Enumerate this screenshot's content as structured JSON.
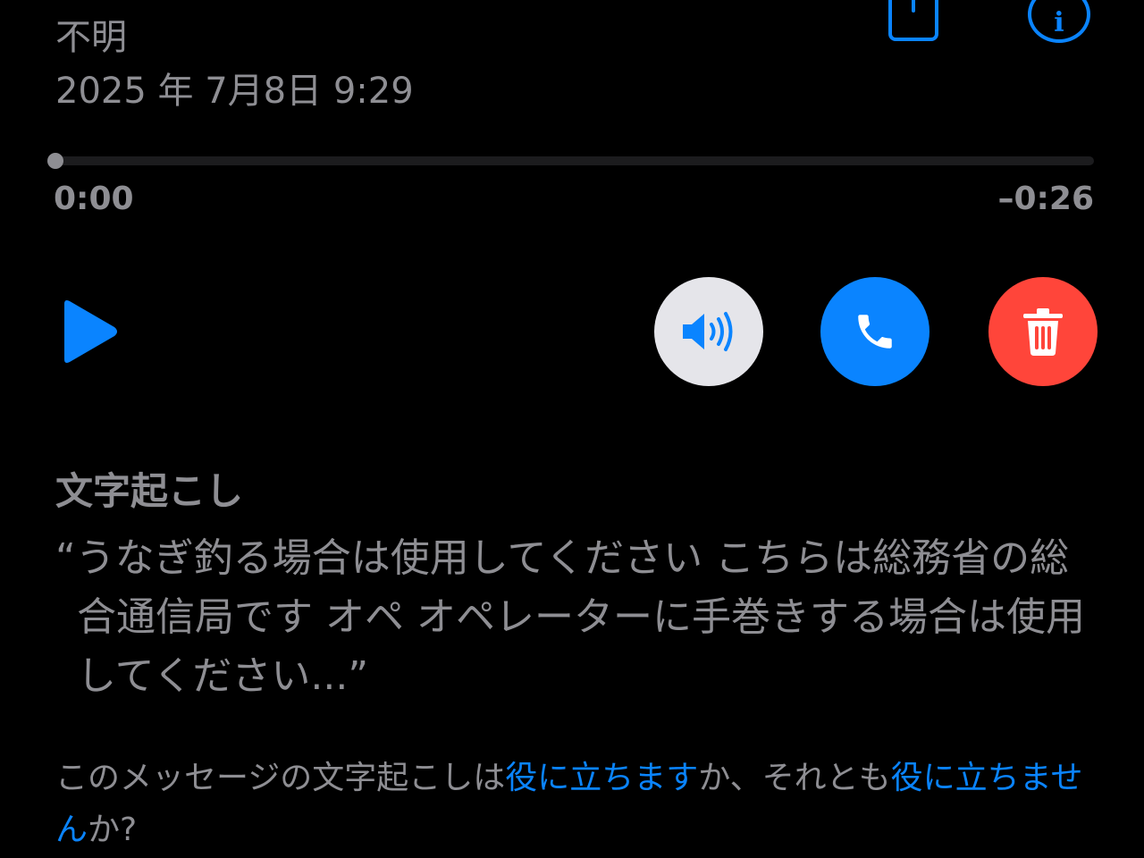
{
  "header": {
    "caller": "不明",
    "datetime": "2025 年 7月8日 9:29"
  },
  "playback": {
    "elapsed": "0:00",
    "remaining": "–0:26",
    "progress": 0.0
  },
  "icons": {
    "play": "play-icon",
    "speaker": "speaker-icon",
    "call": "phone-icon",
    "delete": "trash-icon",
    "share": "share-icon",
    "info": "info-icon"
  },
  "colors": {
    "accent": "#0a84ff",
    "delete": "#ff453a",
    "speaker_bg": "#e5e5ea",
    "text_secondary": "#8e8e93"
  },
  "transcription": {
    "heading": "文字起こし",
    "text": "“うなぎ釣る場合は使用してください こちらは総務省の総合通信局です オペ オペレーターに手巻きする場合は使用してください...”"
  },
  "feedback": {
    "prefix": "このメッセージの文字起こしは",
    "helpful": "役に立ちます",
    "middle": "か、それとも",
    "not_helpful": "役に立ちません",
    "suffix": "か?"
  }
}
